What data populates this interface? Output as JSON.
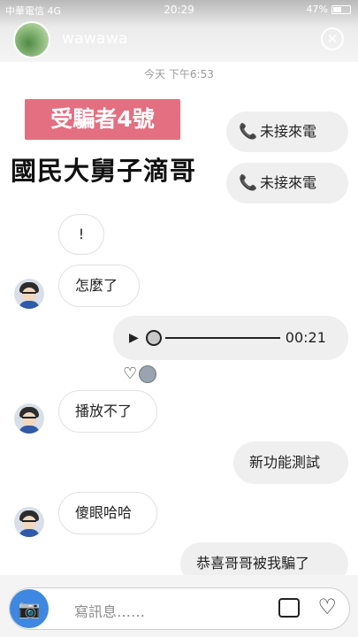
{
  "status_bar": {
    "carrier": "中華電信 4G",
    "time": "20:29",
    "battery": "47%"
  },
  "header": {
    "username": "wawawa",
    "close_symbol": "✕"
  },
  "datestamp": "今天 下午6:53",
  "sticker": {
    "tag": "受騙者4號",
    "title": "國民大舅子滴哥"
  },
  "messages": {
    "call1": "未接來電",
    "call2": "未接來電",
    "m_exclaim": "!",
    "m_what": "怎麼了",
    "voice_duration": "00:21",
    "m_cant_play": "播放不了",
    "m_new_feature": "新功能測試",
    "m_dumbfounded": "傻眼哈哈",
    "m_fooled": "恭喜哥哥被我騙了"
  },
  "composer": {
    "placeholder": "寫訊息……"
  },
  "icons": {
    "phone": "📞",
    "play": "▶",
    "heart": "♡",
    "camera": "📷"
  },
  "colors": {
    "tag_pink": "#e36f81",
    "camera_blue": "#3f88e1",
    "bubble_gray": "#efefef"
  }
}
